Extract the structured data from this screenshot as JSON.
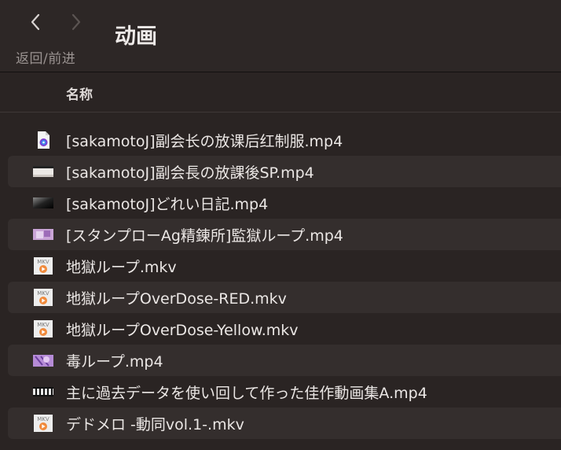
{
  "toolbar": {
    "back_icon": "chevron-left-icon",
    "forward_icon": "chevron-right-icon",
    "nav_label": "返回/前进",
    "title": "动画"
  },
  "list_header": {
    "name_column": "名称"
  },
  "files": [
    {
      "name": "[sakamotoJ]副会长の放课后红制服.mp4",
      "icon": "quicktime-document-icon"
    },
    {
      "name": "[sakamotoJ]副会長の放課後SP.mp4",
      "icon": "video-thumbnail-icon"
    },
    {
      "name": "[sakamotoJ]どれい日記.mp4",
      "icon": "video-thumbnail-icon"
    },
    {
      "name": "[スタンプローAg精錬所]監獄ループ.mp4",
      "icon": "video-thumbnail-icon"
    },
    {
      "name": "地獄ループ.mkv",
      "icon": "mkv-file-icon",
      "icon_text": "MKV"
    },
    {
      "name": "地獄ループOverDose-RED.mkv",
      "icon": "mkv-file-icon",
      "icon_text": "MKV"
    },
    {
      "name": "地獄ループOverDose-Yellow.mkv",
      "icon": "mkv-file-icon",
      "icon_text": "MKV"
    },
    {
      "name": "毒ループ.mp4",
      "icon": "video-thumbnail-icon"
    },
    {
      "name": "主に過去データを使い回して作った佳作動画集A.mp4",
      "icon": "video-thumbnail-icon"
    },
    {
      "name": "デドメロ -動同vol.1-.mkv",
      "icon": "mkv-file-icon",
      "icon_text": "MKV"
    }
  ]
}
